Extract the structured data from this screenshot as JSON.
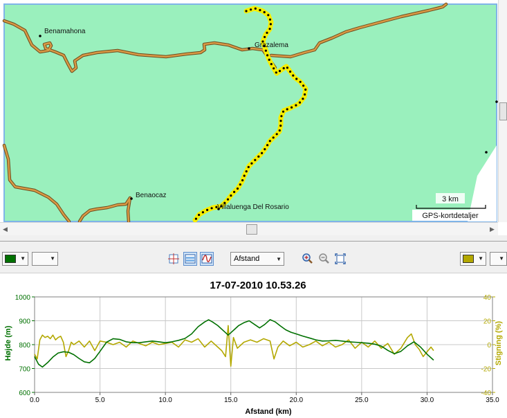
{
  "map": {
    "places": [
      {
        "name": "Benamahona"
      },
      {
        "name": "Grazalema"
      },
      {
        "name": "Benaocaz"
      },
      {
        "name": "Villaluenga Del Rosario"
      }
    ],
    "scale_label": "3 km",
    "details_label": "GPS-kortdetaljer",
    "colors": {
      "land": "#9af0bd",
      "road": "#d99a45",
      "track": "#f6ee00",
      "border": "#7fb4e8"
    }
  },
  "toolbar": {
    "left_color": "#007000",
    "right_color": "#b3a800",
    "xaxis_select": "Afstand",
    "icons": [
      "crosshair-icon",
      "split-view-icon",
      "wave-icon",
      "zoom-in-icon",
      "zoom-out-icon",
      "zoom-fit-icon"
    ]
  },
  "chart_data": {
    "type": "line",
    "title": "17-07-2010 10.53.26",
    "xlabel": "Afstand (km)",
    "ylabel": "Højde (m)",
    "y2label": "Stigning (%)",
    "xlim": [
      0,
      35
    ],
    "ylim": [
      600,
      1000
    ],
    "y2lim": [
      -40,
      40
    ],
    "xticks": [
      0,
      5,
      10,
      15,
      20,
      25,
      30,
      35
    ],
    "yticks": [
      600,
      700,
      800,
      900,
      1000
    ],
    "y2ticks": [
      -40,
      -20,
      0,
      20,
      40
    ],
    "grid": true,
    "series": [
      {
        "name": "Højde (m)",
        "axis": "left",
        "color": "#007000",
        "x": [
          0,
          0.3,
          0.6,
          1.0,
          1.4,
          1.8,
          2.2,
          2.6,
          3.0,
          3.4,
          3.8,
          4.2,
          4.6,
          5.0,
          5.5,
          6.0,
          6.5,
          7.0,
          7.5,
          8.0,
          8.5,
          9.0,
          9.5,
          10.0,
          10.5,
          11.0,
          11.5,
          12.0,
          12.5,
          13.0,
          13.3,
          13.6,
          14.0,
          14.4,
          14.8,
          15.0,
          15.3,
          15.6,
          16.0,
          16.4,
          16.8,
          17.2,
          17.6,
          18.0,
          18.4,
          18.8,
          19.2,
          19.6,
          20.0,
          20.5,
          21.0,
          21.5,
          22.0,
          22.5,
          23.0,
          23.5,
          24.0,
          24.5,
          25.0,
          25.5,
          26.0,
          26.5,
          27.0,
          27.5,
          28.0,
          28.5,
          29.0,
          29.5,
          30.0,
          30.5
        ],
        "y": [
          750,
          718,
          706,
          725,
          748,
          765,
          770,
          768,
          758,
          742,
          728,
          724,
          742,
          772,
          810,
          825,
          822,
          812,
          808,
          808,
          812,
          815,
          812,
          808,
          812,
          818,
          826,
          845,
          875,
          895,
          904,
          895,
          880,
          860,
          840,
          850,
          865,
          880,
          892,
          900,
          885,
          870,
          885,
          905,
          895,
          878,
          862,
          852,
          845,
          836,
          828,
          820,
          815,
          816,
          818,
          815,
          812,
          810,
          808,
          806,
          802,
          794,
          776,
          762,
          772,
          795,
          812,
          790,
          760,
          735
        ]
      },
      {
        "name": "Stigning (%)",
        "axis": "right",
        "color": "#b3a800",
        "x": [
          0,
          0.2,
          0.4,
          0.6,
          0.8,
          1.0,
          1.2,
          1.4,
          1.6,
          1.8,
          2.0,
          2.2,
          2.4,
          2.6,
          2.8,
          3.0,
          3.4,
          3.8,
          4.2,
          4.6,
          5.0,
          5.5,
          6.0,
          6.5,
          7.0,
          7.5,
          8.0,
          8.5,
          9.0,
          9.5,
          10.0,
          10.5,
          11.0,
          11.5,
          12.0,
          12.5,
          13.0,
          13.5,
          14.0,
          14.3,
          14.6,
          14.8,
          15.0,
          15.2,
          15.5,
          16.0,
          16.5,
          17.0,
          17.5,
          18.0,
          18.3,
          18.6,
          19.0,
          19.5,
          20.0,
          20.5,
          21.0,
          21.5,
          22.0,
          22.5,
          23.0,
          23.5,
          24.0,
          24.5,
          25.0,
          25.5,
          26.0,
          26.5,
          27.0,
          27.5,
          28.0,
          28.5,
          28.8,
          29.1,
          29.4,
          29.7,
          30.0,
          30.3,
          30.5
        ],
        "y": [
          -8,
          -12,
          4,
          8,
          6,
          7,
          5,
          8,
          4,
          6,
          7,
          2,
          -10,
          -5,
          2,
          0,
          3,
          -2,
          3,
          -5,
          3,
          2,
          0,
          2,
          -2,
          3,
          1,
          -1,
          2,
          0,
          1,
          2,
          -2,
          4,
          2,
          5,
          -2,
          3,
          -2,
          -5,
          -10,
          16,
          -18,
          6,
          -3,
          2,
          4,
          2,
          5,
          3,
          -12,
          -2,
          3,
          -1,
          2,
          -2,
          0,
          3,
          -1,
          2,
          -2,
          0,
          4,
          -3,
          2,
          -2,
          3,
          -3,
          1,
          -8,
          -3,
          6,
          9,
          0,
          -4,
          -10,
          -6,
          -2,
          -5
        ]
      }
    ]
  }
}
